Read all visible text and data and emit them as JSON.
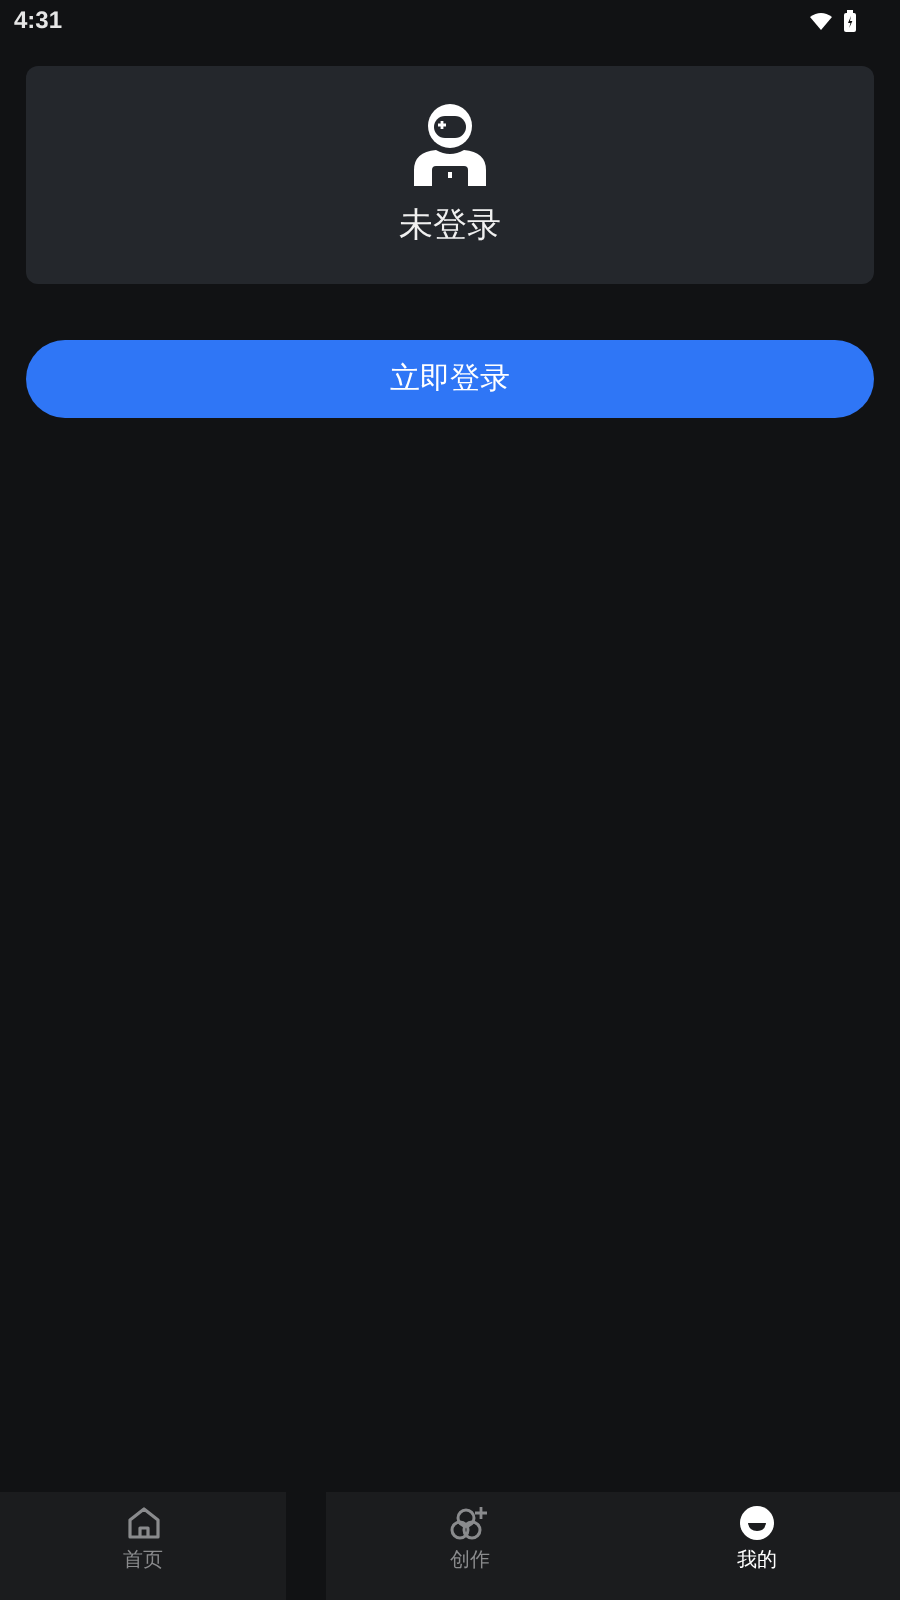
{
  "status_bar": {
    "time": "4:31"
  },
  "profile": {
    "status": "未登录"
  },
  "login_button": {
    "label": "立即登录"
  },
  "nav": [
    {
      "label": "首页",
      "kind": "home",
      "selected": false
    },
    {
      "label": "创作",
      "kind": "create",
      "selected": false
    },
    {
      "label": "我的",
      "kind": "me",
      "selected": true
    }
  ]
}
